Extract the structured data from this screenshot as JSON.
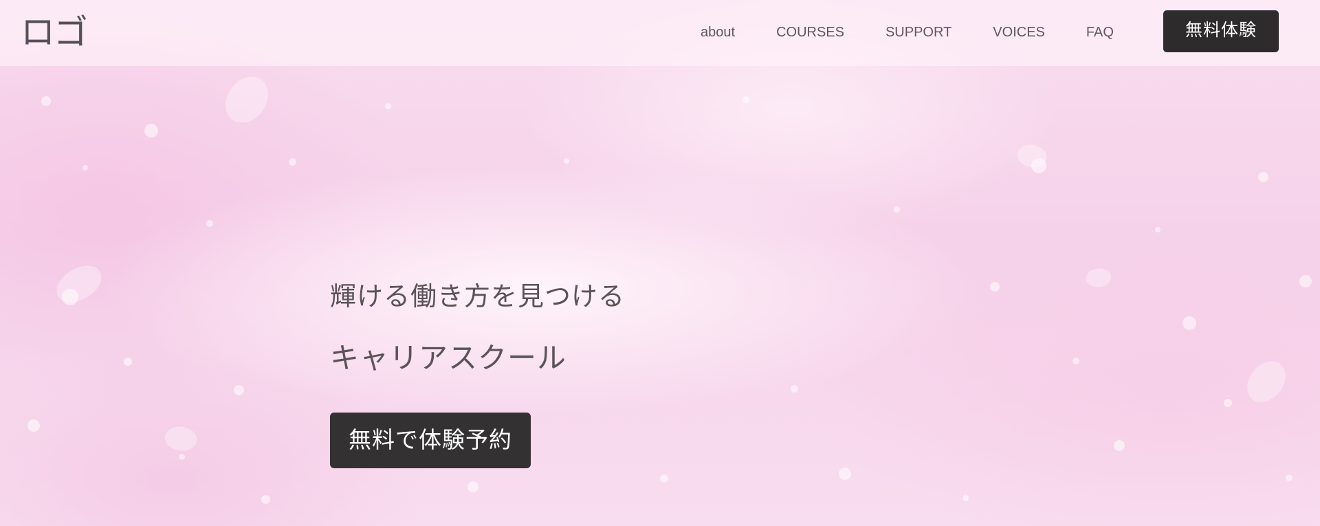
{
  "header": {
    "logo": "ロゴ",
    "nav": [
      {
        "label": "about"
      },
      {
        "label": "COURSES"
      },
      {
        "label": "SUPPORT"
      },
      {
        "label": "VOICES"
      },
      {
        "label": "FAQ"
      }
    ],
    "cta_label": "無料体験"
  },
  "hero": {
    "tagline": "輝ける働き方を見つける",
    "headline": "キャリアスクール",
    "cta_label": "無料で体験予約"
  },
  "colors": {
    "background": "#f7d6ec",
    "button": "#2d2b2c",
    "button_text": "#ffffff",
    "text": "#5a5357"
  }
}
